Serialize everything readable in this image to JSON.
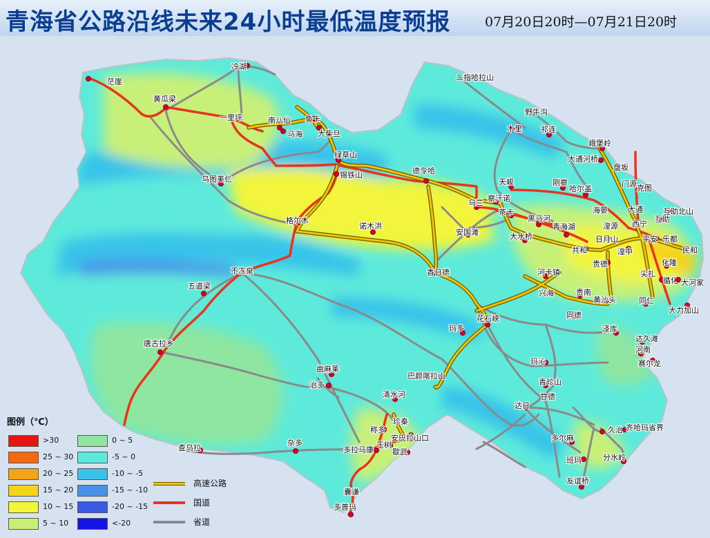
{
  "header": {
    "title": "青海省公路沿线未来24小时最低温度预报",
    "date_range": "07月20日20时—07月21日20时"
  },
  "colors": {
    "lt_neg20": "#1414e6",
    "neg20_neg15": "#3a5ae6",
    "neg15_neg10": "#4a92e8",
    "neg10_neg5": "#39c3ea",
    "neg5_0": "#5eeadb",
    "r0_5": "#8ee6a0",
    "r5_10": "#c8f078",
    "r10_15": "#f2f53a",
    "r15_20": "#f5d318",
    "r20_25": "#f5a418",
    "r25_30": "#f26a12",
    "gt30": "#e81414",
    "expressway": "#f5c400",
    "national_road": "#e8341c",
    "provincial_road": "#8a8a8a",
    "city_marker": "#d8002a"
  },
  "legend": {
    "title": "图例（℃）",
    "items": [
      {
        "label": ">30",
        "color": "#e81414"
      },
      {
        "label": "25 ~ 30",
        "color": "#f26a12"
      },
      {
        "label": "20 ~ 25",
        "color": "#f5a418"
      },
      {
        "label": "15 ~ 20",
        "color": "#f5d318"
      },
      {
        "label": "10 ~ 15",
        "color": "#f2f53a"
      },
      {
        "label": "5 ~ 10",
        "color": "#c8f078"
      },
      {
        "label": "0 ~ 5",
        "color": "#8ee6a0"
      },
      {
        "label": "-5 ~ 0",
        "color": "#5eeadb"
      },
      {
        "label": "-10 ~ -5",
        "color": "#39c3ea"
      },
      {
        "label": "-15 ~ -10",
        "color": "#4a92e8"
      },
      {
        "label": "-20 ~ -15",
        "color": "#3a5ae6"
      },
      {
        "label": "<-20",
        "color": "#1414e6"
      }
    ]
  },
  "road_legend": {
    "expressway": "高速公路",
    "national": "国道",
    "provincial": "省道"
  },
  "cities": {
    "mangya": "茫崖",
    "lenghu": "冷湖",
    "huanggualiang": "黄瓜梁",
    "yilipin": "一里坪",
    "nanbaxian": "南八仙",
    "yuka": "鱼卡",
    "mahai": "马海",
    "dachaidan": "大柴旦",
    "lvcaoshan": "绿草山",
    "xitieshan": "锡铁山",
    "wutumeiren": "乌图美仁",
    "delingha": "德令哈",
    "golmud": "格尔木",
    "nuomuhong": "诺木洪",
    "wulan": "乌兰",
    "chahannuo": "察汗诺",
    "tianjun": "天峻",
    "gangcha": "刚察",
    "haergai": "哈尔盖",
    "chaka": "茶卡",
    "heimahe": "黑马河",
    "qinghaihu": "青海湖",
    "dashuiqiao": "大水桥",
    "anguotan": "安国滩",
    "xiangride": "香日德",
    "budongquan": "不冻泉",
    "wudaoliang": "五道梁",
    "tanggula": "唐古拉乡",
    "erzhi": "二指哈拉山",
    "yeniugou": "野牛沟",
    "muli": "木里",
    "qilian": "祁连",
    "ebaoling": "峨堡岭",
    "datonghe": "大通河桥",
    "panba": "盘坂",
    "menyuan": "门源",
    "ke": "克图",
    "haiyan": "海晏",
    "datong": "大通",
    "huzhubeishan": "互助北山",
    "huangyuan": "湟源",
    "xining": "西宁",
    "huzhu": "互助",
    "riyueshan": "日月山",
    "ping_an": "平安",
    "ledu": "乐都",
    "minhe": "民和",
    "gonghe": "共和",
    "huangzhong": "湟中",
    "guide": "贵德",
    "hualong": "化隆",
    "jianzha": "尖扎",
    "xunhua": "循化",
    "dahejia": "大河家",
    "hekazhen": "河卡镇",
    "xinghai": "兴海",
    "guinan": "贵南",
    "huangshatou": "黄沙头",
    "tongren": "同仁",
    "dalijiashan": "大力加山",
    "tongde": "同德",
    "huashixia": "花石峡",
    "maduo": "玛多",
    "zeku": "泽库",
    "dajiutan": "达久滩",
    "henan": "河南",
    "saierlong": "赛尔龙",
    "maqin": "玛沁",
    "qingzhenshan": "青珍山",
    "gande": "甘德",
    "bayankala": "巴颜喀拉山",
    "qumalai": "曲麻莱",
    "zhiduo": "治多",
    "qingshuihe": "清水河",
    "zhenqin": "珍秦",
    "chengduo": "称多",
    "anbalashankou": "安巴拉山口",
    "yushu": "玉树",
    "xiewu": "歇武",
    "dari": "达日",
    "jiuzhi": "久治",
    "qihamasheng": "齐哈玛省界",
    "banma": "班玛",
    "fenshuiling": "分水岭",
    "duolanma": "多尔麻",
    "youyiqiao": "友谊桥",
    "zaduo": "杂多",
    "chawula": "查乌拉",
    "duolamakang": "多拉马康",
    "nangqian": "囊谦",
    "duopuma": "多普玛"
  }
}
